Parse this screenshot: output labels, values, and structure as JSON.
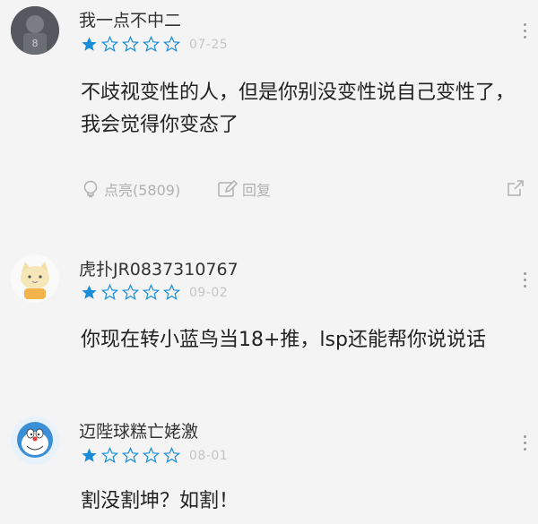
{
  "comments": [
    {
      "username": "我一点不中二",
      "stars_filled": 1,
      "stars_total": 5,
      "date": "07-25",
      "text": "不歧视变性的人，但是你别没变性说自己变性了，我会觉得你变态了",
      "like_label": "点亮(5809)",
      "reply_label": "回复",
      "avatar_badge": "8"
    },
    {
      "username": "虎扑JR0837310767",
      "stars_filled": 1,
      "stars_total": 5,
      "date": "09-02",
      "text": "你现在转小蓝鸟当18+推，lsp还能帮你说说话"
    },
    {
      "username": "迈陛球糕亡姥激",
      "stars_filled": 1,
      "stars_total": 5,
      "date": "08-01",
      "text": "割没割坤？如割！"
    }
  ],
  "colors": {
    "star": "#1a8dd8",
    "muted": "#b0b0b0",
    "date": "#c4c4c4",
    "background": "#f4f4f4"
  },
  "icons": [
    "more-vertical-icon",
    "lightbulb-icon",
    "reply-edit-icon",
    "share-icon"
  ]
}
